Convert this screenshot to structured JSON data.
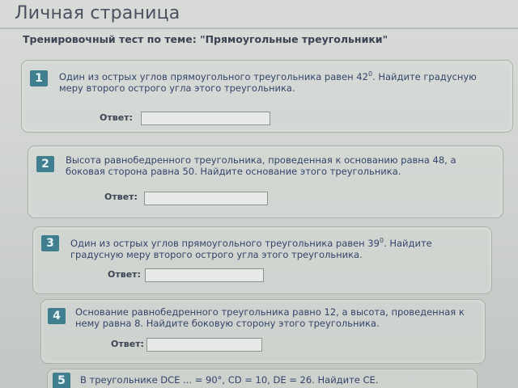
{
  "page": {
    "title": "Личная страница",
    "test_title": "Тренировочный тест по теме: \"Прямоугольные треугольники\""
  },
  "answer_label": "Ответ:",
  "questions": [
    {
      "number": "1",
      "text_before": "Один из острых углов прямоугольного треугольника равен 42",
      "sup": "0",
      "text_after": ". Найдите градусную меру второго острого угла этого треугольника.",
      "answer": ""
    },
    {
      "number": "2",
      "text_before": "Высота равнобедренного треугольника, проведенная к основанию равна 48, а боковая сторона равна 50. Найдите основание этого треугольника.",
      "sup": "",
      "text_after": "",
      "answer": ""
    },
    {
      "number": "3",
      "text_before": "Один из острых углов прямоугольного треугольника равен 39",
      "sup": "0",
      "text_after": ". Найдите градусную меру второго острого угла этого треугольника.",
      "answer": ""
    },
    {
      "number": "4",
      "text_before": "Основание равнобедренного треугольника равно 12, а высота, проведенная к нему равна 8. Найдите боковую сторону этого треугольника.",
      "sup": "",
      "text_after": "",
      "answer": ""
    },
    {
      "number": "5",
      "text_before": "В треугольнике DCE ... = 90°, CD = 10, DE = 26. Найдите CE.",
      "sup": "",
      "text_after": "",
      "answer": ""
    }
  ],
  "colors": {
    "number_badge": "#3f7f90",
    "question_text": "#34446a",
    "card_border": "#aab1aa"
  }
}
